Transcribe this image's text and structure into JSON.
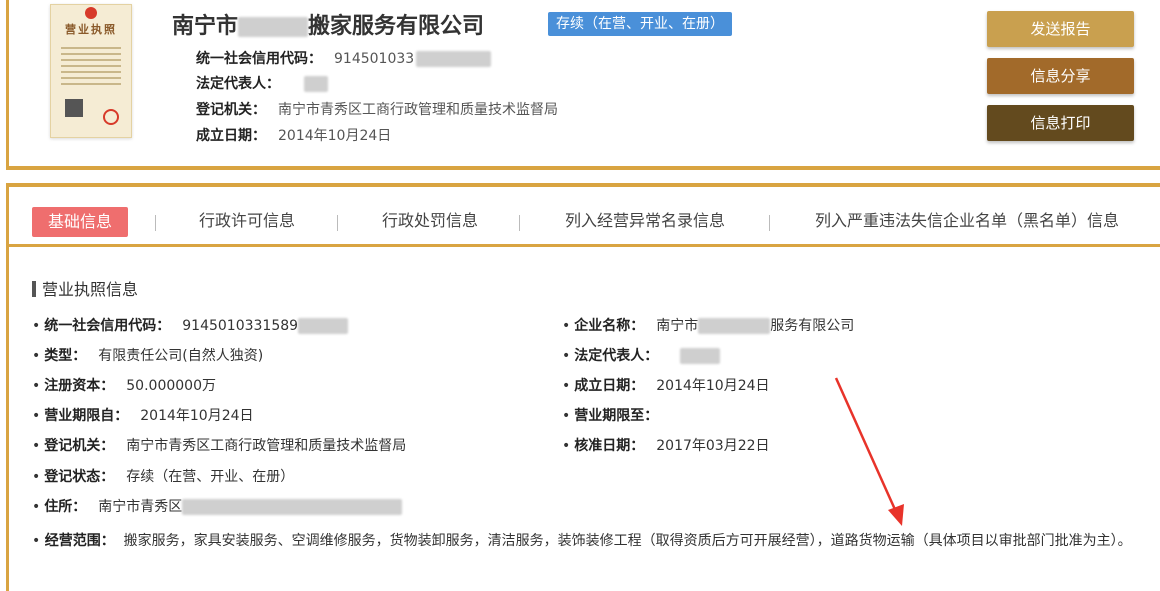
{
  "header": {
    "company_name_prefix": "南宁市",
    "company_name_suffix": "搬家服务有限公司",
    "status_badge": "存续（在营、开业、在册）",
    "license_title": "营业执照",
    "rows": [
      {
        "label": "统一社会信用代码：",
        "value": "914501033"
      },
      {
        "label": "法定代表人：",
        "value": ""
      },
      {
        "label": "登记机关：",
        "value": "南宁市青秀区工商行政管理和质量技术监督局"
      },
      {
        "label": "成立日期：",
        "value": "2014年10月24日"
      }
    ]
  },
  "actions": {
    "send_report": "发送报告",
    "share_info": "信息分享",
    "print_info": "信息打印"
  },
  "tabs": [
    {
      "label": "基础信息",
      "active": true
    },
    {
      "label": "行政许可信息",
      "active": false
    },
    {
      "label": "行政处罚信息",
      "active": false
    },
    {
      "label": "列入经营异常名录信息",
      "active": false
    },
    {
      "label": "列入严重违法失信企业名单（黑名单）信息",
      "active": false
    }
  ],
  "section": {
    "title": "营业执照信息",
    "left": [
      {
        "label": "统一社会信用代码：",
        "value": "9145010331589"
      },
      {
        "label": "类型：",
        "value": "有限责任公司(自然人独资)"
      },
      {
        "label": "注册资本：",
        "value": "50.000000万"
      },
      {
        "label": "营业期限自：",
        "value": "2014年10月24日"
      },
      {
        "label": "登记机关：",
        "value": "南宁市青秀区工商行政管理和质量技术监督局"
      },
      {
        "label": "登记状态：",
        "value": "存续（在营、开业、在册）"
      },
      {
        "label": "住所：",
        "value": "南宁市青秀区"
      }
    ],
    "right": [
      {
        "label": "企业名称：",
        "value_prefix": "南宁市",
        "value_suffix": "服务有限公司"
      },
      {
        "label": "法定代表人：",
        "value_prefix": "",
        "value_suffix": ""
      },
      {
        "label": "成立日期：",
        "value_prefix": "2014年10月24日",
        "value_suffix": ""
      },
      {
        "label": "营业期限至：",
        "value_prefix": "",
        "value_suffix": ""
      },
      {
        "label": "核准日期：",
        "value_prefix": "2017年03月22日",
        "value_suffix": ""
      }
    ],
    "scope_label": "经营范围：",
    "scope_value": "搬家服务，家具安装服务、空调维修服务，货物装卸服务，清洁服务，装饰装修工程（取得资质后方可开展经营），道路货物运输（具体项目以审批部门批准为主）。"
  },
  "colors": {
    "gold_border": "#d9a441",
    "badge_blue": "#4a90d9",
    "tab_active": "#ef6e6e",
    "annotation_arrow": "#e8332a"
  }
}
